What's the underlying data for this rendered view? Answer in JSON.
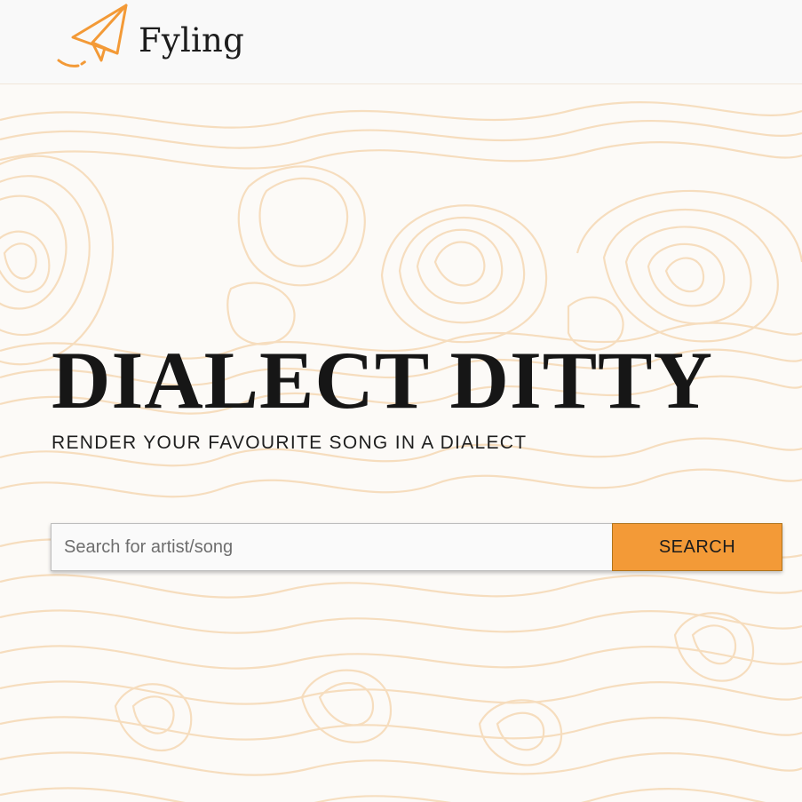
{
  "header": {
    "brand_name": "Fyling",
    "logo_icon": "paper-plane-icon"
  },
  "hero": {
    "title": "DIALECT DITTY",
    "subtitle": "RENDER YOUR FAVOURITE SONG IN A DIALECT",
    "background_pattern": "topographic-contour-lines"
  },
  "search": {
    "placeholder": "Search for artist/song",
    "value": "",
    "button_label": "SEARCH"
  },
  "colors": {
    "accent": "#f39a37",
    "contour_lines": "#f6d9b4",
    "header_background": "#f9f9f9",
    "text": "#161616"
  }
}
